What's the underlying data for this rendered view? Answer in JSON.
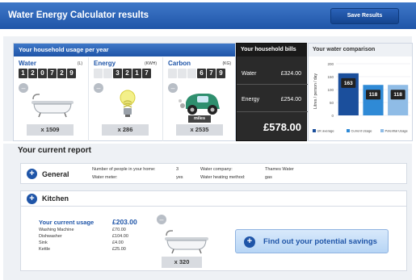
{
  "header": {
    "title": "Water Energy Calculator results",
    "save_label": "Save Results"
  },
  "usage": {
    "heading": "Your household usage per year",
    "water": {
      "label": "Water",
      "unit": "(L)",
      "digits": [
        "1",
        "2",
        "0",
        "7",
        "2",
        "9"
      ],
      "count": "x 1509"
    },
    "energy": {
      "label": "Energy",
      "unit": "(KWH)",
      "digits": [
        "",
        "",
        "3",
        "2",
        "1",
        "7"
      ],
      "count": "x 286"
    },
    "carbon": {
      "label": "Carbon",
      "unit": "(KG)",
      "digits": [
        "",
        "",
        "",
        "6",
        "7",
        "9"
      ],
      "count": "x 2535",
      "miles_label": "miles"
    }
  },
  "bills": {
    "heading": "Your household bills",
    "water_label": "Water",
    "water_value": "£324.00",
    "energy_label": "Energy",
    "energy_value": "£254.00",
    "total": "£578.00"
  },
  "comparison": {
    "heading": "Your water comparison",
    "accent": "#1f55a8"
  },
  "chart_data": {
    "type": "bar",
    "categories": [
      "UK average",
      "Current Usage",
      "Potential Usage"
    ],
    "values": [
      163,
      118,
      118
    ],
    "ylabel": "Litres / person / day",
    "ylim": [
      0,
      200
    ],
    "yticks": [
      "200",
      "150",
      "100",
      "50",
      "0"
    ],
    "colors": [
      "#1b4f9c",
      "#2f8ad6",
      "#8fbce6"
    ]
  },
  "report": {
    "heading": "Your current report",
    "general": {
      "title": "General",
      "people_label": "Number of people in your home:",
      "people_value": "3",
      "meter_label": "Water meter:",
      "meter_value": "yes",
      "company_label": "Water company:",
      "company_value": "Thames Water",
      "heating_label": "Water heating method:",
      "heating_value": "gas"
    },
    "kitchen": {
      "title": "Kitchen",
      "current_label": "Your current usage",
      "current_total": "£203.00",
      "items": [
        {
          "name": "Washing Machine",
          "value": "£70.00"
        },
        {
          "name": "Dishwasher",
          "value": "£104.00"
        },
        {
          "name": "Sink",
          "value": "£4.00"
        },
        {
          "name": "Kettle",
          "value": "£25.00"
        }
      ],
      "count": "x 320",
      "find_label": "Find out your potential savings"
    }
  }
}
